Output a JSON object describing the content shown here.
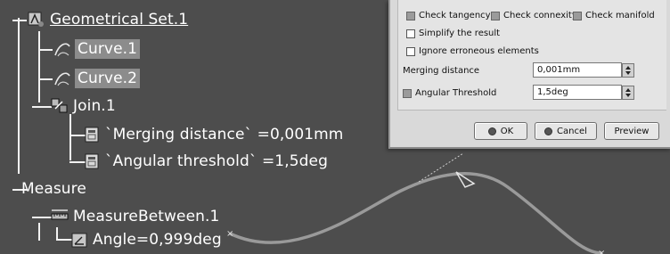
{
  "tree": {
    "geometrical_set": "Geometrical Set.1",
    "curve1": "Curve.1",
    "curve2": "Curve.2",
    "join": "Join.1",
    "merging": "`Merging distance` =0,001mm",
    "angular": "`Angular threshold` =1,5deg",
    "measure": "Measure",
    "measure_between": "MeasureBetween.1",
    "angle": "Angle=0,999deg"
  },
  "dialog": {
    "check_tangency": "Check tangency",
    "check_connexity": "Check connexity",
    "check_manifold": "Check manifold",
    "simplify": "Simplify the result",
    "ignore": "Ignore erroneous elements",
    "merging_label": "Merging distance",
    "merging_value": "0,001mm",
    "angular_label": "Angular Threshold",
    "angular_value": "1,5deg",
    "ok": "OK",
    "cancel": "Cancel",
    "preview": "Preview"
  },
  "colors": {
    "background": "#4d4d4d",
    "highlight": "#8c8c8c",
    "curve": "#9a9a9a"
  }
}
